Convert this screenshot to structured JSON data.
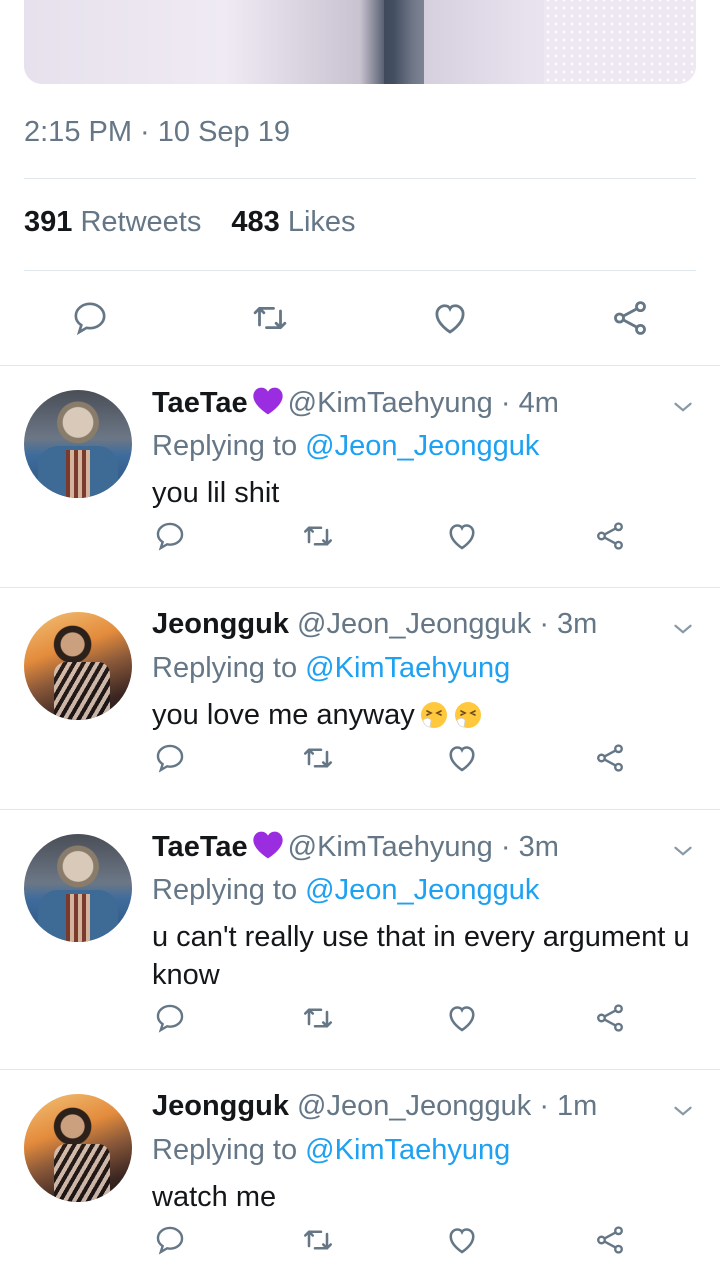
{
  "tweet": {
    "timestamp": "2:15 PM · 10 Sep 19",
    "retweet_count": "391",
    "retweet_label": "Retweets",
    "like_count": "483",
    "like_label": "Likes"
  },
  "icons": {
    "reply": "reply-icon",
    "retweet": "retweet-icon",
    "like": "heart-icon",
    "share": "share-icon",
    "more": "chevron-down-icon"
  },
  "colors": {
    "link": "#1da1f2",
    "muted": "#657786",
    "text": "#14171a",
    "heart_emoji": "#9b2de0"
  },
  "replies": [
    {
      "name": "TaeTae",
      "has_heart": true,
      "handle": "@KimTaehyung",
      "time": "4m",
      "replying_prefix": "Replying to",
      "replying_to": "@Jeon_Jeongguk",
      "text": "you lil shit",
      "emoji_count": 0
    },
    {
      "name": "Jeongguk",
      "has_heart": false,
      "handle": "@Jeon_Jeongguk",
      "time": "3m",
      "replying_prefix": "Replying to",
      "replying_to": "@KimTaehyung",
      "text": "you love me anyway",
      "emoji_count": 2
    },
    {
      "name": "TaeTae",
      "has_heart": true,
      "handle": "@KimTaehyung",
      "time": "3m",
      "replying_prefix": "Replying to",
      "replying_to": "@Jeon_Jeongguk",
      "text": "u can't really use that in every argument u know",
      "emoji_count": 0
    },
    {
      "name": "Jeongguk",
      "has_heart": false,
      "handle": "@Jeon_Jeongguk",
      "time": "1m",
      "replying_prefix": "Replying to",
      "replying_to": "@KimTaehyung",
      "text": "watch me",
      "emoji_count": 0
    }
  ]
}
